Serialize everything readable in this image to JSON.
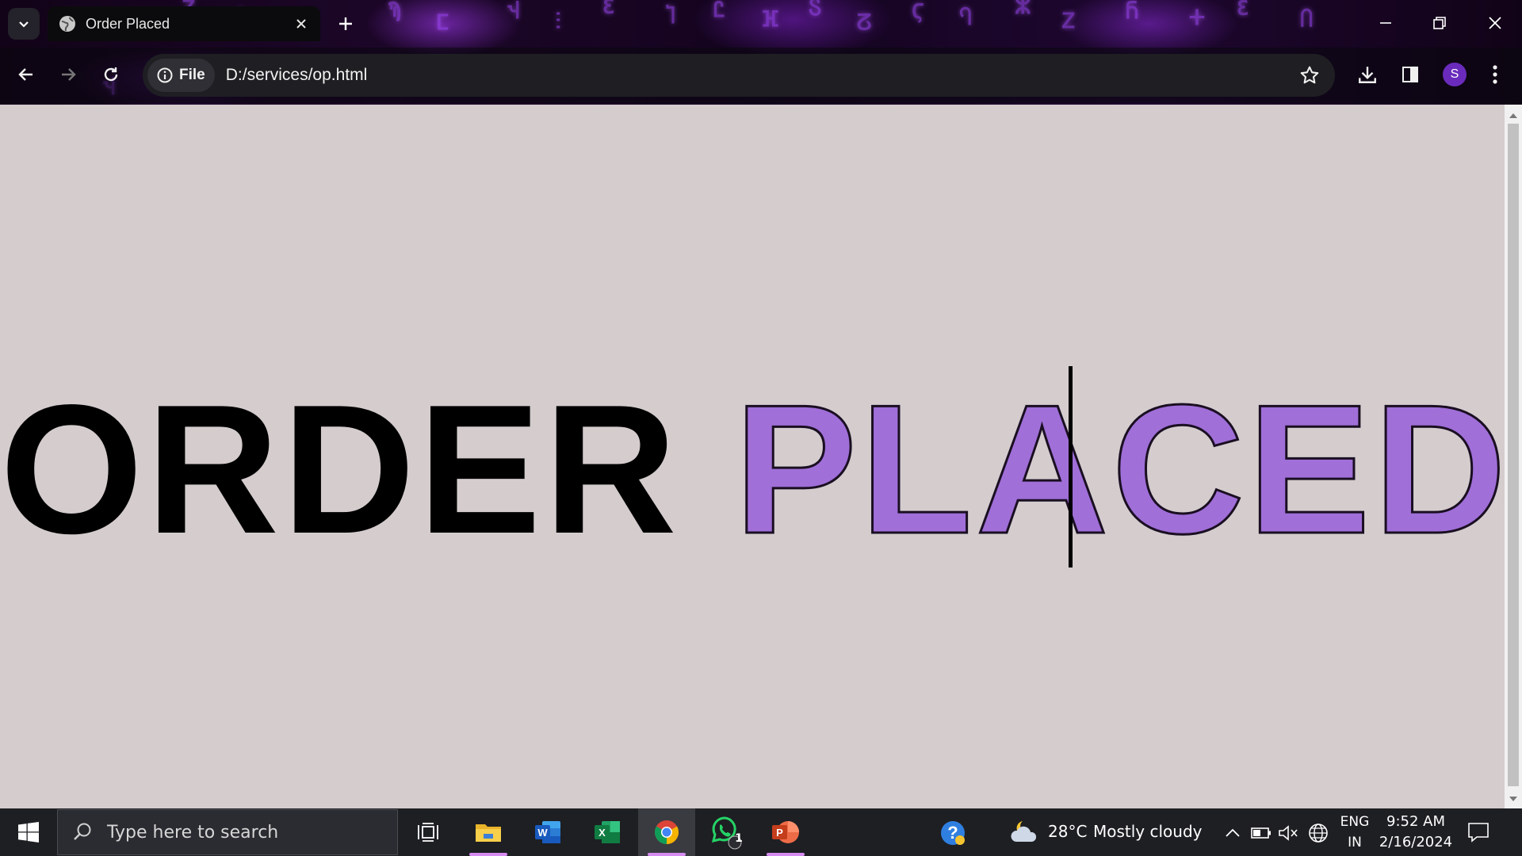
{
  "browser": {
    "tab": {
      "title": "Order Placed"
    },
    "toolbar": {
      "site_chip_label": "File",
      "url": "D:/services/op.html",
      "profile_initial": "S"
    }
  },
  "page": {
    "headline_word1": "ORDER",
    "headline_word2": "PLACED",
    "colors": {
      "background": "#d4cccd",
      "word1": "#000000",
      "word2": "#a06fd8"
    }
  },
  "taskbar": {
    "search_placeholder": "Type here to search",
    "apps": [
      "task-view",
      "file-explorer",
      "word",
      "excel",
      "chrome",
      "whatsapp",
      "powerpoint"
    ],
    "whatsapp_badge": "1",
    "weather": {
      "temp": "28°C",
      "condition": "Mostly cloudy"
    },
    "language": {
      "line1": "ENG",
      "line2": "IN"
    },
    "clock": {
      "time": "9:52 AM",
      "date": "2/16/2024"
    }
  }
}
